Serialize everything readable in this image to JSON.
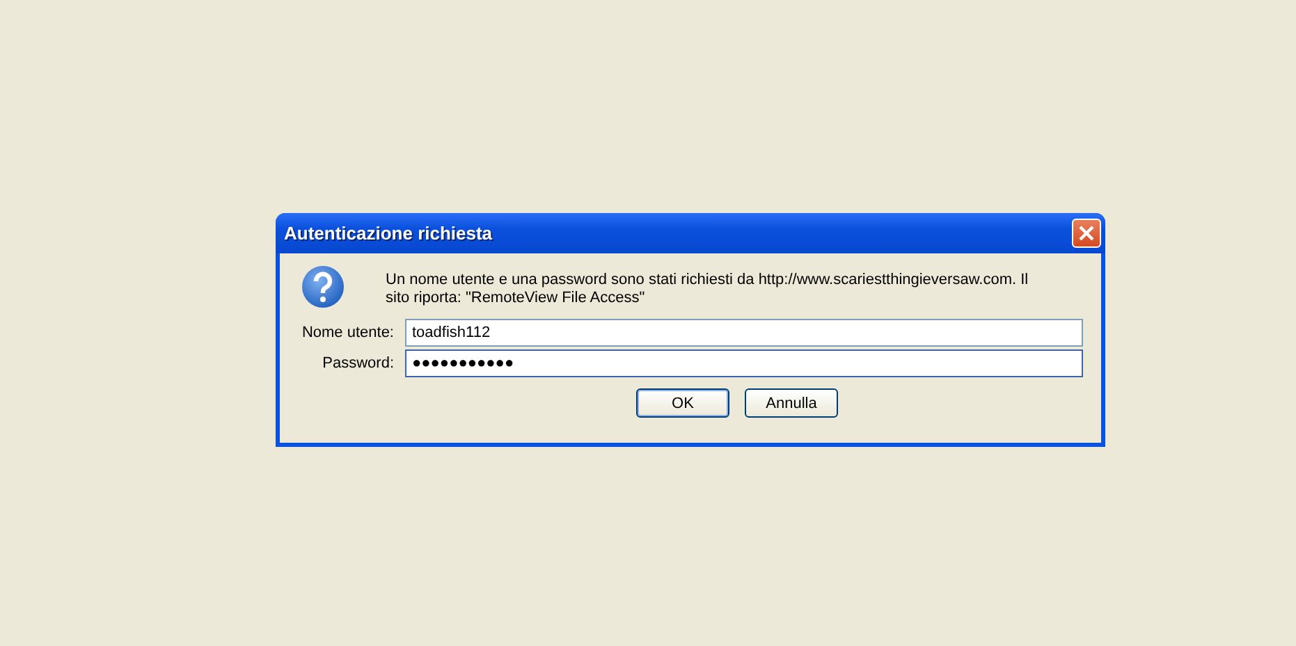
{
  "window": {
    "title": "Autenticazione richiesta"
  },
  "message": "Un nome utente e una password sono stati richiesti da http://www.scariestthingieversaw.com. Il sito riporta: \"RemoteView File Access\"",
  "fields": [
    {
      "label": "Nome utente:",
      "value": "toadfish112",
      "focused": false
    },
    {
      "label": "Password:",
      "value": "●●●●●●●●●●●",
      "focused": true
    }
  ],
  "buttons": [
    {
      "label": "OK",
      "default": true
    },
    {
      "label": "Annulla",
      "default": false
    }
  ]
}
